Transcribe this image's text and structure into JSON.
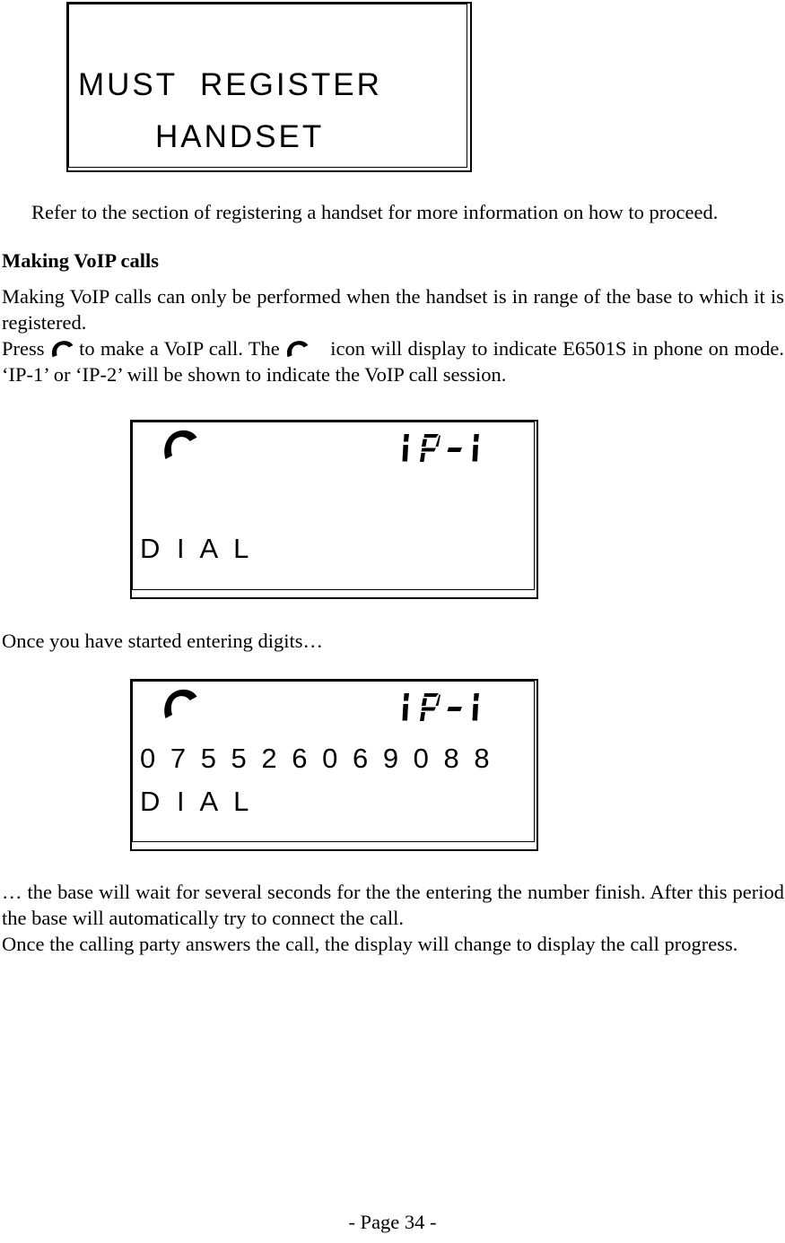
{
  "page": {
    "footer": "- Page 34 -"
  },
  "displays": {
    "register": {
      "line1": "MUST  REGISTER",
      "line2": "HANDSET"
    },
    "dial_empty": {
      "handset_icon": "phone-handset-icon",
      "indicator": "IP-1",
      "indicator_chars": [
        "I",
        "P",
        "-",
        "1"
      ],
      "digits": "",
      "status": "D I A L"
    },
    "dial_number": {
      "handset_icon": "phone-handset-icon",
      "indicator": "IP-1",
      "indicator_chars": [
        "I",
        "P",
        "-",
        "1"
      ],
      "digits": "0 7 5 5 2 6 0 6 9 0 8 8",
      "status": "D I A L"
    }
  },
  "body": {
    "refer": "Refer to the section of registering a handset for more information on how to proceed.",
    "heading_making": "Making VoIP calls",
    "making_intro": "Making VoIP calls can only be performed when the handset is in range of the base to which it is registered.",
    "press_part1": "Press",
    "press_part2": "to make a VoIP call. The",
    "press_part3": "icon will display to indicate E6501S in phone on mode. ‘IP-1’ or ‘IP-2’ will be shown to indicate the VoIP call session.",
    "once_digits": "Once you have started entering digits…",
    "wait": "… the base will wait for several seconds for the the entering the number finish.  After this period the base will automatically try to connect the call.",
    "progress": "Once the calling party answers the call, the display will change to display the call progress."
  },
  "colors": {
    "ink": "#000000",
    "paper": "#ffffff"
  }
}
